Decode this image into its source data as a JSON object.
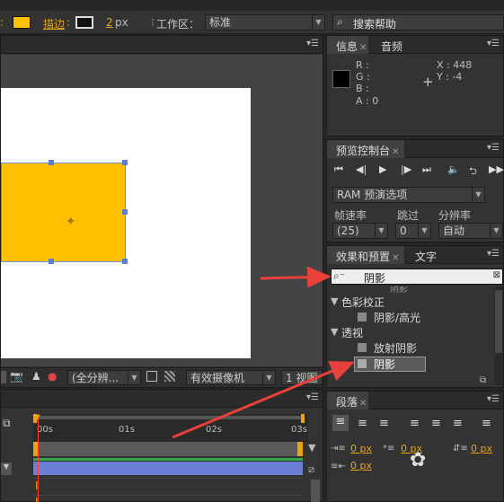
{
  "toolbar": {
    "fill_label": "",
    "stroke_label": "描边",
    "stroke_px": "2",
    "px_unit": "px",
    "workspace_label": "工作区：",
    "workspace_value": "标准",
    "search_help_placeholder": "搜索帮助",
    "colors": {
      "fill": "#ffc000",
      "label": "#e8a317"
    }
  },
  "composition": {
    "shape_color": "#ffc000",
    "canvas_color": "#ffffff",
    "footer": {
      "view_dropdown": "(全分辨...",
      "camera_dropdown": "有效摄像机",
      "views_dropdown": "1 视图"
    }
  },
  "info_panel": {
    "tabs": [
      "信息",
      "音频"
    ],
    "r_label": "R :",
    "g_label": "G :",
    "b_label": "B :",
    "a_label": "A : 0",
    "x_label": "X : 448",
    "y_label": "Y : -4"
  },
  "preview_panel": {
    "title": "预览控制台",
    "ram_dropdown": "RAM 预演选项",
    "frame_rate_label": "帧速率",
    "skip_label": "跳过",
    "resolution_label": "分辨率",
    "frame_rate_value": "(25)",
    "skip_value": "0",
    "resolution_value": "自动"
  },
  "effects_panel": {
    "tabs": [
      "效果和预置",
      "文字"
    ],
    "search_value": "阴影",
    "partial_item": "阴影",
    "groups": [
      {
        "name": "色彩校正",
        "items": [
          "阴影/高光"
        ]
      },
      {
        "name": "透视",
        "items": [
          "放射阴影",
          "阴影"
        ]
      }
    ]
  },
  "paragraph_panel": {
    "title": "段落",
    "indent_left": "0 px",
    "indent_first": "0 px",
    "space_before": "0 px",
    "indent_right": "0 px"
  },
  "timeline": {
    "ticks": [
      "00s",
      "01s",
      "02s",
      "03s"
    ]
  },
  "annotation_color": "#e8413b"
}
